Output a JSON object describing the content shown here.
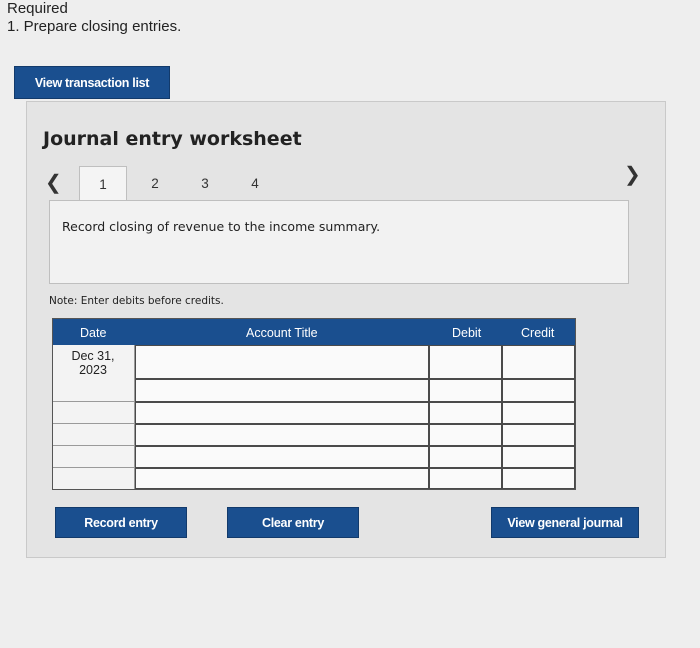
{
  "header": {
    "required": "Required",
    "task": "1. Prepare closing entries."
  },
  "buttons": {
    "view_transactions": "View transaction list",
    "record_entry": "Record entry",
    "clear_entry": "Clear entry",
    "view_general_journal": "View general journal"
  },
  "worksheet": {
    "title": "Journal entry worksheet",
    "prev_icon": "chevron-left-icon",
    "next_icon": "chevron-right-icon",
    "tabs": [
      {
        "label": "1"
      },
      {
        "label": "2"
      },
      {
        "label": "3"
      },
      {
        "label": "4"
      }
    ],
    "prompt": "Record closing of revenue to the income summary.",
    "note": "Note: Enter debits before credits."
  },
  "table": {
    "columns": {
      "date": "Date",
      "account": "Account Title",
      "debit": "Debit",
      "credit": "Credit"
    },
    "rows": [
      {
        "date_line1": "Dec 31,",
        "date_line2": "2023"
      },
      {
        "date_line1": "",
        "date_line2": ""
      },
      {
        "date_line1": "",
        "date_line2": ""
      },
      {
        "date_line1": "",
        "date_line2": ""
      },
      {
        "date_line1": "",
        "date_line2": ""
      },
      {
        "date_line1": "",
        "date_line2": ""
      }
    ]
  },
  "colors": {
    "primary": "#1a4f8f",
    "background": "#eeeeee"
  }
}
